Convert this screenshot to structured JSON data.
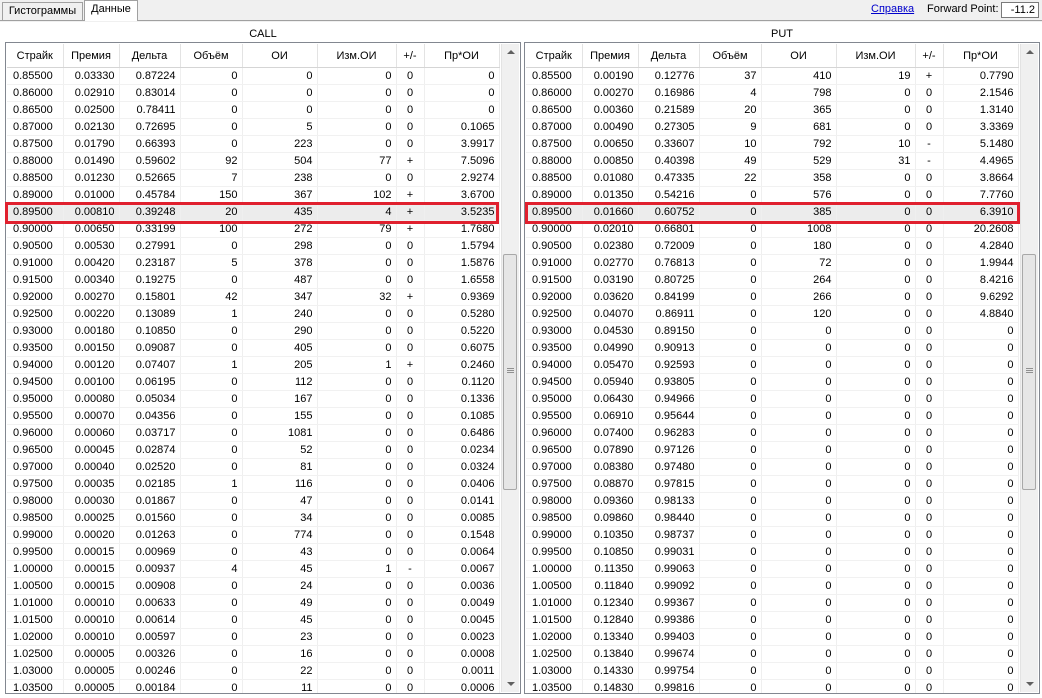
{
  "tabs": [
    {
      "label": "Гистограммы",
      "active": false
    },
    {
      "label": "Данные",
      "active": true
    }
  ],
  "help_link": "Справка",
  "forward_point": {
    "label": "Forward Point:",
    "value": "-11.2"
  },
  "call": {
    "title": "CALL",
    "columns": [
      "Страйк",
      "Премия",
      "Дельта",
      "Объём",
      "ОИ",
      "Изм.ОИ",
      "+/-",
      "Пр*ОИ"
    ],
    "highlight_index": 9,
    "rows": [
      [
        "0.85500",
        "0.03330",
        "0.87224",
        "0",
        "0",
        "0",
        "0",
        "0"
      ],
      [
        "0.86000",
        "0.02910",
        "0.83014",
        "0",
        "0",
        "0",
        "0",
        "0"
      ],
      [
        "0.86500",
        "0.02500",
        "0.78411",
        "0",
        "0",
        "0",
        "0",
        "0"
      ],
      [
        "0.87000",
        "0.02130",
        "0.72695",
        "0",
        "5",
        "0",
        "0",
        "0.1065"
      ],
      [
        "0.87500",
        "0.01790",
        "0.66393",
        "0",
        "223",
        "0",
        "0",
        "3.9917"
      ],
      [
        "0.88000",
        "0.01490",
        "0.59602",
        "92",
        "504",
        "77",
        "+",
        "7.5096"
      ],
      [
        "0.88500",
        "0.01230",
        "0.52665",
        "7",
        "238",
        "0",
        "0",
        "2.9274"
      ],
      [
        "0.89000",
        "0.01000",
        "0.45784",
        "150",
        "367",
        "102",
        "+",
        "3.6700"
      ],
      [
        "0.89500",
        "0.00810",
        "0.39248",
        "20",
        "435",
        "4",
        "+",
        "3.5235"
      ],
      [
        "0.90000",
        "0.00650",
        "0.33199",
        "100",
        "272",
        "79",
        "+",
        "1.7680"
      ],
      [
        "0.90500",
        "0.00530",
        "0.27991",
        "0",
        "298",
        "0",
        "0",
        "1.5794"
      ],
      [
        "0.91000",
        "0.00420",
        "0.23187",
        "5",
        "378",
        "0",
        "0",
        "1.5876"
      ],
      [
        "0.91500",
        "0.00340",
        "0.19275",
        "0",
        "487",
        "0",
        "0",
        "1.6558"
      ],
      [
        "0.92000",
        "0.00270",
        "0.15801",
        "42",
        "347",
        "32",
        "+",
        "0.9369"
      ],
      [
        "0.92500",
        "0.00220",
        "0.13089",
        "1",
        "240",
        "0",
        "0",
        "0.5280"
      ],
      [
        "0.93000",
        "0.00180",
        "0.10850",
        "0",
        "290",
        "0",
        "0",
        "0.5220"
      ],
      [
        "0.93500",
        "0.00150",
        "0.09087",
        "0",
        "405",
        "0",
        "0",
        "0.6075"
      ],
      [
        "0.94000",
        "0.00120",
        "0.07407",
        "1",
        "205",
        "1",
        "+",
        "0.2460"
      ],
      [
        "0.94500",
        "0.00100",
        "0.06195",
        "0",
        "112",
        "0",
        "0",
        "0.1120"
      ],
      [
        "0.95000",
        "0.00080",
        "0.05034",
        "0",
        "167",
        "0",
        "0",
        "0.1336"
      ],
      [
        "0.95500",
        "0.00070",
        "0.04356",
        "0",
        "155",
        "0",
        "0",
        "0.1085"
      ],
      [
        "0.96000",
        "0.00060",
        "0.03717",
        "0",
        "1081",
        "0",
        "0",
        "0.6486"
      ],
      [
        "0.96500",
        "0.00045",
        "0.02874",
        "0",
        "52",
        "0",
        "0",
        "0.0234"
      ],
      [
        "0.97000",
        "0.00040",
        "0.02520",
        "0",
        "81",
        "0",
        "0",
        "0.0324"
      ],
      [
        "0.97500",
        "0.00035",
        "0.02185",
        "1",
        "116",
        "0",
        "0",
        "0.0406"
      ],
      [
        "0.98000",
        "0.00030",
        "0.01867",
        "0",
        "47",
        "0",
        "0",
        "0.0141"
      ],
      [
        "0.98500",
        "0.00025",
        "0.01560",
        "0",
        "34",
        "0",
        "0",
        "0.0085"
      ],
      [
        "0.99000",
        "0.00020",
        "0.01263",
        "0",
        "774",
        "0",
        "0",
        "0.1548"
      ],
      [
        "0.99500",
        "0.00015",
        "0.00969",
        "0",
        "43",
        "0",
        "0",
        "0.0064"
      ],
      [
        "1.00000",
        "0.00015",
        "0.00937",
        "4",
        "45",
        "1",
        "-",
        "0.0067"
      ],
      [
        "1.00500",
        "0.00015",
        "0.00908",
        "0",
        "24",
        "0",
        "0",
        "0.0036"
      ],
      [
        "1.01000",
        "0.00010",
        "0.00633",
        "0",
        "49",
        "0",
        "0",
        "0.0049"
      ],
      [
        "1.01500",
        "0.00010",
        "0.00614",
        "0",
        "45",
        "0",
        "0",
        "0.0045"
      ],
      [
        "1.02000",
        "0.00010",
        "0.00597",
        "0",
        "23",
        "0",
        "0",
        "0.0023"
      ],
      [
        "1.02500",
        "0.00005",
        "0.00326",
        "0",
        "16",
        "0",
        "0",
        "0.0008"
      ],
      [
        "1.03000",
        "0.00005",
        "0.00246",
        "0",
        "22",
        "0",
        "0",
        "0.0011"
      ],
      [
        "1.03500",
        "0.00005",
        "0.00184",
        "0",
        "11",
        "0",
        "0",
        "0.0006"
      ]
    ]
  },
  "put": {
    "title": "PUT",
    "columns": [
      "Страйк",
      "Премия",
      "Дельта",
      "Объём",
      "ОИ",
      "Изм.ОИ",
      "+/-",
      "Пр*ОИ"
    ],
    "highlight_index": 9,
    "rows": [
      [
        "0.85500",
        "0.00190",
        "0.12776",
        "37",
        "410",
        "19",
        "+",
        "0.7790"
      ],
      [
        "0.86000",
        "0.00270",
        "0.16986",
        "4",
        "798",
        "0",
        "0",
        "2.1546"
      ],
      [
        "0.86500",
        "0.00360",
        "0.21589",
        "20",
        "365",
        "0",
        "0",
        "1.3140"
      ],
      [
        "0.87000",
        "0.00490",
        "0.27305",
        "9",
        "681",
        "0",
        "0",
        "3.3369"
      ],
      [
        "0.87500",
        "0.00650",
        "0.33607",
        "10",
        "792",
        "10",
        "-",
        "5.1480"
      ],
      [
        "0.88000",
        "0.00850",
        "0.40398",
        "49",
        "529",
        "31",
        "-",
        "4.4965"
      ],
      [
        "0.88500",
        "0.01080",
        "0.47335",
        "22",
        "358",
        "0",
        "0",
        "3.8664"
      ],
      [
        "0.89000",
        "0.01350",
        "0.54216",
        "0",
        "576",
        "0",
        "0",
        "7.7760"
      ],
      [
        "0.89500",
        "0.01660",
        "0.60752",
        "0",
        "385",
        "0",
        "0",
        "6.3910"
      ],
      [
        "0.90000",
        "0.02010",
        "0.66801",
        "0",
        "1008",
        "0",
        "0",
        "20.2608"
      ],
      [
        "0.90500",
        "0.02380",
        "0.72009",
        "0",
        "180",
        "0",
        "0",
        "4.2840"
      ],
      [
        "0.91000",
        "0.02770",
        "0.76813",
        "0",
        "72",
        "0",
        "0",
        "1.9944"
      ],
      [
        "0.91500",
        "0.03190",
        "0.80725",
        "0",
        "264",
        "0",
        "0",
        "8.4216"
      ],
      [
        "0.92000",
        "0.03620",
        "0.84199",
        "0",
        "266",
        "0",
        "0",
        "9.6292"
      ],
      [
        "0.92500",
        "0.04070",
        "0.86911",
        "0",
        "120",
        "0",
        "0",
        "4.8840"
      ],
      [
        "0.93000",
        "0.04530",
        "0.89150",
        "0",
        "0",
        "0",
        "0",
        "0"
      ],
      [
        "0.93500",
        "0.04990",
        "0.90913",
        "0",
        "0",
        "0",
        "0",
        "0"
      ],
      [
        "0.94000",
        "0.05470",
        "0.92593",
        "0",
        "0",
        "0",
        "0",
        "0"
      ],
      [
        "0.94500",
        "0.05940",
        "0.93805",
        "0",
        "0",
        "0",
        "0",
        "0"
      ],
      [
        "0.95000",
        "0.06430",
        "0.94966",
        "0",
        "0",
        "0",
        "0",
        "0"
      ],
      [
        "0.95500",
        "0.06910",
        "0.95644",
        "0",
        "0",
        "0",
        "0",
        "0"
      ],
      [
        "0.96000",
        "0.07400",
        "0.96283",
        "0",
        "0",
        "0",
        "0",
        "0"
      ],
      [
        "0.96500",
        "0.07890",
        "0.97126",
        "0",
        "0",
        "0",
        "0",
        "0"
      ],
      [
        "0.97000",
        "0.08380",
        "0.97480",
        "0",
        "0",
        "0",
        "0",
        "0"
      ],
      [
        "0.97500",
        "0.08870",
        "0.97815",
        "0",
        "0",
        "0",
        "0",
        "0"
      ],
      [
        "0.98000",
        "0.09360",
        "0.98133",
        "0",
        "0",
        "0",
        "0",
        "0"
      ],
      [
        "0.98500",
        "0.09860",
        "0.98440",
        "0",
        "0",
        "0",
        "0",
        "0"
      ],
      [
        "0.99000",
        "0.10350",
        "0.98737",
        "0",
        "0",
        "0",
        "0",
        "0"
      ],
      [
        "0.99500",
        "0.10850",
        "0.99031",
        "0",
        "0",
        "0",
        "0",
        "0"
      ],
      [
        "1.00000",
        "0.11350",
        "0.99063",
        "0",
        "0",
        "0",
        "0",
        "0"
      ],
      [
        "1.00500",
        "0.11840",
        "0.99092",
        "0",
        "0",
        "0",
        "0",
        "0"
      ],
      [
        "1.01000",
        "0.12340",
        "0.99367",
        "0",
        "0",
        "0",
        "0",
        "0"
      ],
      [
        "1.01500",
        "0.12840",
        "0.99386",
        "0",
        "0",
        "0",
        "0",
        "0"
      ],
      [
        "1.02000",
        "0.13340",
        "0.99403",
        "0",
        "0",
        "0",
        "0",
        "0"
      ],
      [
        "1.02500",
        "0.13840",
        "0.99674",
        "0",
        "0",
        "0",
        "0",
        "0"
      ],
      [
        "1.03000",
        "0.14330",
        "0.99754",
        "0",
        "0",
        "0",
        "0",
        "0"
      ],
      [
        "1.03500",
        "0.14830",
        "0.99816",
        "0",
        "0",
        "0",
        "0",
        "0"
      ]
    ]
  },
  "colors": {
    "highlight_border": "#e0202e",
    "selected_row": "#ececec",
    "link": "#0000cc"
  }
}
